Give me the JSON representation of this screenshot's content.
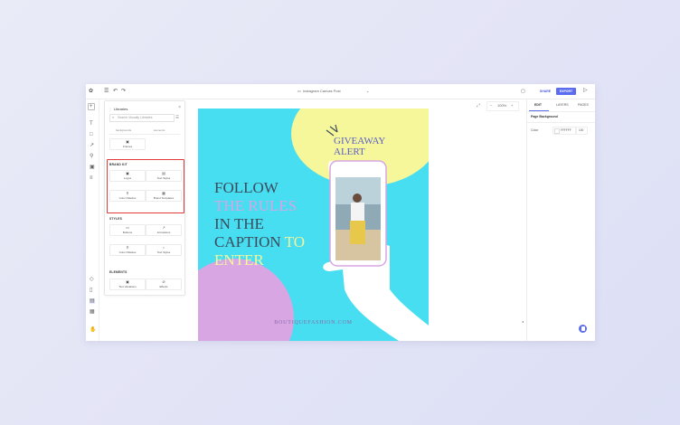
{
  "header": {
    "file_name": "Instagram Canvas Post",
    "share_label": "SHARE",
    "export_label": "EXPORT"
  },
  "libraries": {
    "title": "Libraries",
    "search_placeholder": "Search Visually Libraries",
    "partial_top": [
      "backgrounds",
      "elements"
    ],
    "frames_label": "Frames",
    "brand_kit": {
      "heading": "BRAND KIT",
      "items": [
        "Logos",
        "Text Styles",
        "Color Palettes",
        "Brand Templates"
      ]
    },
    "styles": {
      "heading": "STYLES",
      "items": [
        "Buttons",
        "Animations",
        "Color Palettes",
        "Text Styles"
      ]
    },
    "elements": {
      "heading": "ELEMENTS",
      "items": [
        "Text Variations",
        "Effects"
      ]
    }
  },
  "canvas": {
    "headline_lines": [
      {
        "parts": [
          {
            "text": "FOLLOW",
            "color": "#3d4b5c"
          }
        ]
      },
      {
        "parts": [
          {
            "text": "THE RULES",
            "color": "#d7a6e3"
          }
        ]
      },
      {
        "parts": [
          {
            "text": "IN THE",
            "color": "#3d4b5c"
          }
        ]
      },
      {
        "parts": [
          {
            "text": "CAPTION ",
            "color": "#3d4b5c"
          },
          {
            "text": "TO",
            "color": "#f6f69a"
          }
        ]
      },
      {
        "parts": [
          {
            "text": "ENTER",
            "color": "#f6f69a"
          }
        ]
      }
    ],
    "giveaway_line1": "GIVEAWAY",
    "giveaway_line2": "ALERT",
    "site": "BOUTIQUEFASHION.COM",
    "colors": {
      "background": "#46def0",
      "yellow_blob": "#f6f69a",
      "purple_blob": "#d7a6e3"
    }
  },
  "zoom_level": "100%",
  "right_panel": {
    "tabs": [
      "EDIT",
      "LAYERS",
      "PAGES"
    ],
    "section": "Page Background",
    "color_label": "Color",
    "color_hex": "FFFFFF",
    "opacity": "100"
  }
}
